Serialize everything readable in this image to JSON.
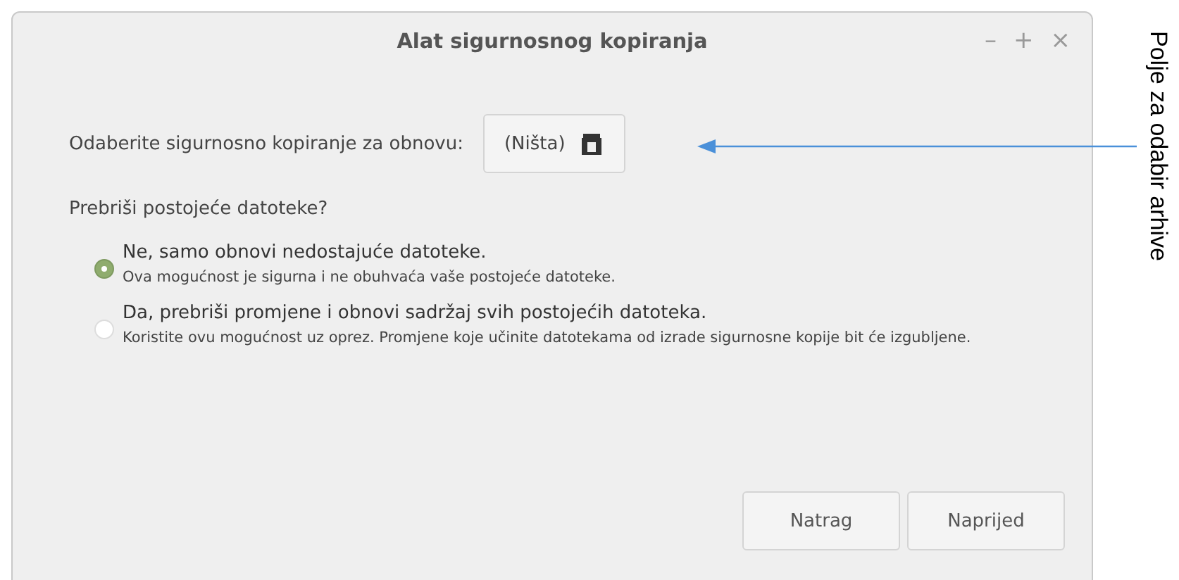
{
  "window": {
    "title": "Alat sigurnosnog kopiranja",
    "controls": [
      "–",
      "+",
      "×"
    ]
  },
  "backup_picker": {
    "label": "Odaberite sigurnosno kopiranje za obnovu:",
    "value": "(Ništa)"
  },
  "question": "Prebriši postojeće datoteke?",
  "options": [
    {
      "label": "Ne, samo obnovi nedostajuće datoteke.",
      "description": "Ova mogućnost je sigurna i ne obuhvaća vaše postojeće datoteke.",
      "selected": true
    },
    {
      "label": "Da, prebriši promjene i obnovi sadržaj svih postojećih datoteka.",
      "description": "Koristite ovu mogućnost uz oprez. Promjene koje učinite datotekama od izrade sigurnosne kopije bit će izgubljene.",
      "selected": false
    }
  ],
  "buttons": [
    "Natrag",
    "Naprijed"
  ],
  "annotation": "Polje za odabir arhive"
}
